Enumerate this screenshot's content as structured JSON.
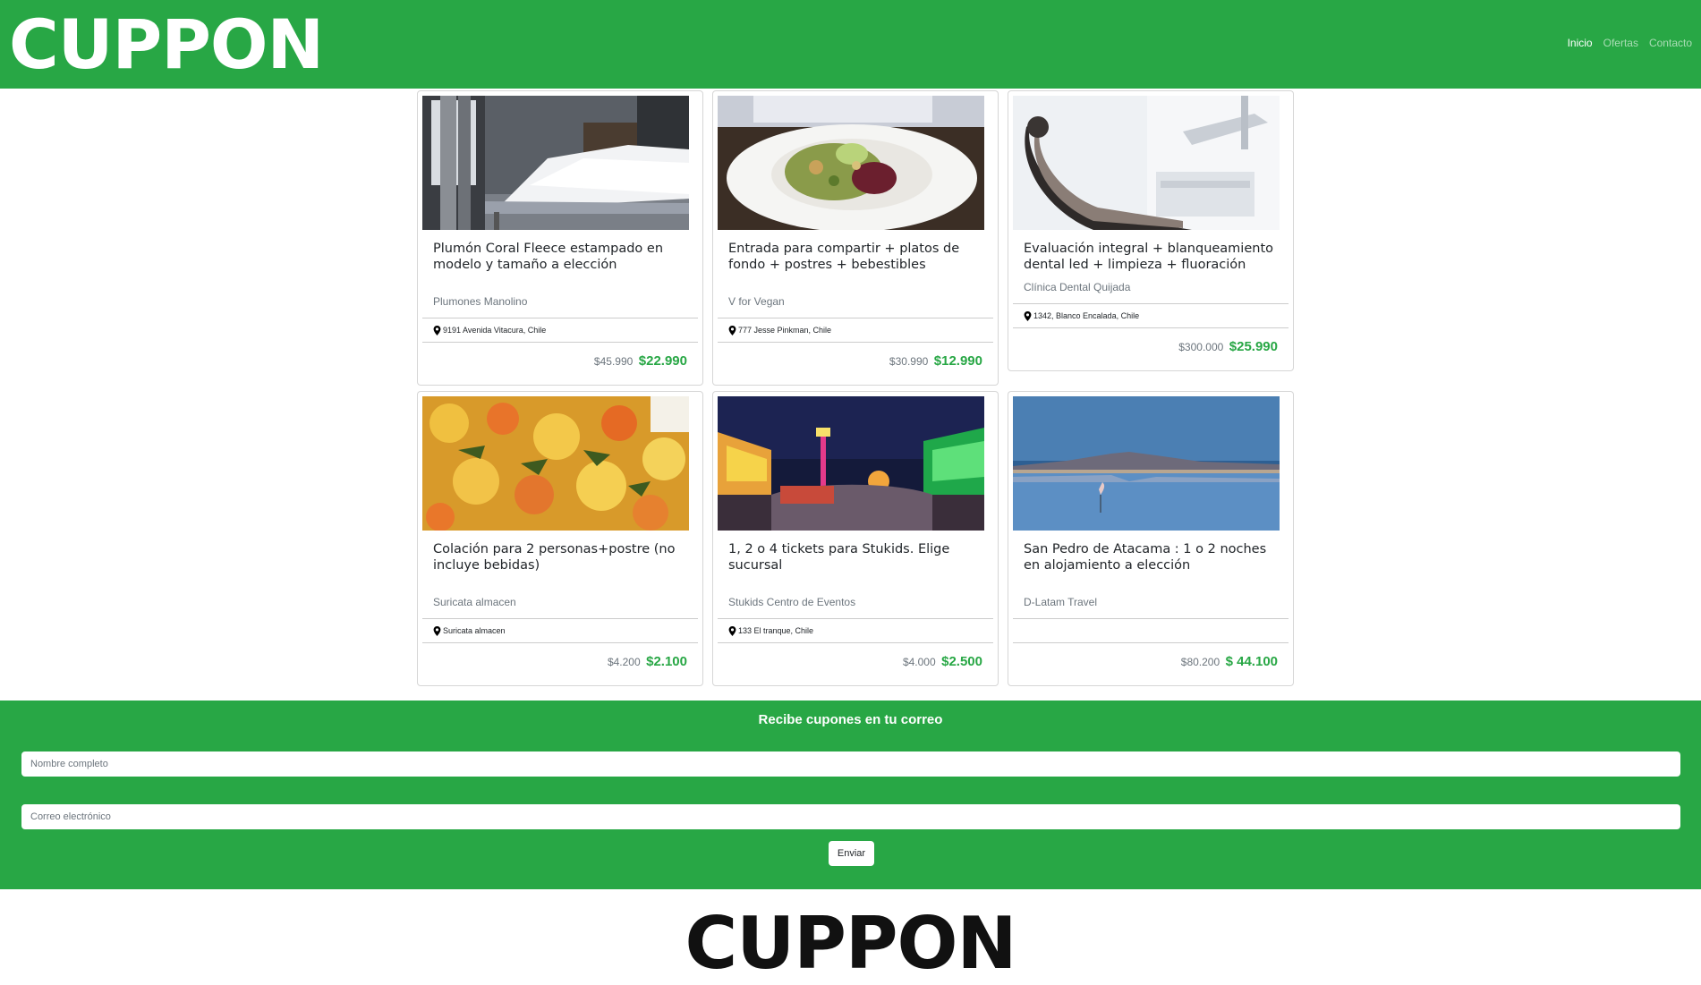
{
  "brand": "CUPPON",
  "nav": [
    "Inicio",
    "Ofertas",
    "Contacto"
  ],
  "deals": [
    {
      "title": "Plumón Coral Fleece estampado en modelo y tamaño a elección",
      "merchant": "Plumones Manolino",
      "location": "9191 Avenida Vitacura, Chile",
      "old_price": "$45.990",
      "price": "$22.990"
    },
    {
      "title": "Entrada para compartir + platos de fondo + postres + bebestibles",
      "merchant": "V for Vegan",
      "location": "777 Jesse Pinkman, Chile",
      "old_price": "$30.990",
      "price": "$12.990"
    },
    {
      "title": "Evaluación integral + blanqueamiento dental led + limpieza + fluoración",
      "merchant": "Clínica Dental Quijada",
      "location": "1342, Blanco Encalada, Chile",
      "old_price": "$300.000",
      "price": "$25.990"
    },
    {
      "title": "Colación para 2 personas+postre (no incluye bebidas)",
      "merchant": "Suricata almacen",
      "location": "Suricata almacen",
      "old_price": "$4.200",
      "price": "$2.100"
    },
    {
      "title": "1, 2 o 4 tickets para Stukids. Elige sucursal",
      "merchant": "Stukids Centro de Eventos",
      "location": "133 El tranque, Chile",
      "old_price": "$4.000",
      "price": "$2.500"
    },
    {
      "title": "San Pedro de Atacama : 1 o 2 noches en alojamiento a elección",
      "merchant": "D-Latam Travel",
      "location": "",
      "old_price": "$80.200",
      "price": "$ 44.100"
    }
  ],
  "newsletter": {
    "title": "Recibe cupones en tu correo",
    "name_placeholder": "Nombre completo",
    "email_placeholder": "Correo electrónico",
    "submit_label": "Enviar"
  },
  "footer": {
    "brand": "CUPPON"
  },
  "colors": {
    "primary": "#28a745",
    "price": "#28a745",
    "muted": "#6c757d"
  }
}
